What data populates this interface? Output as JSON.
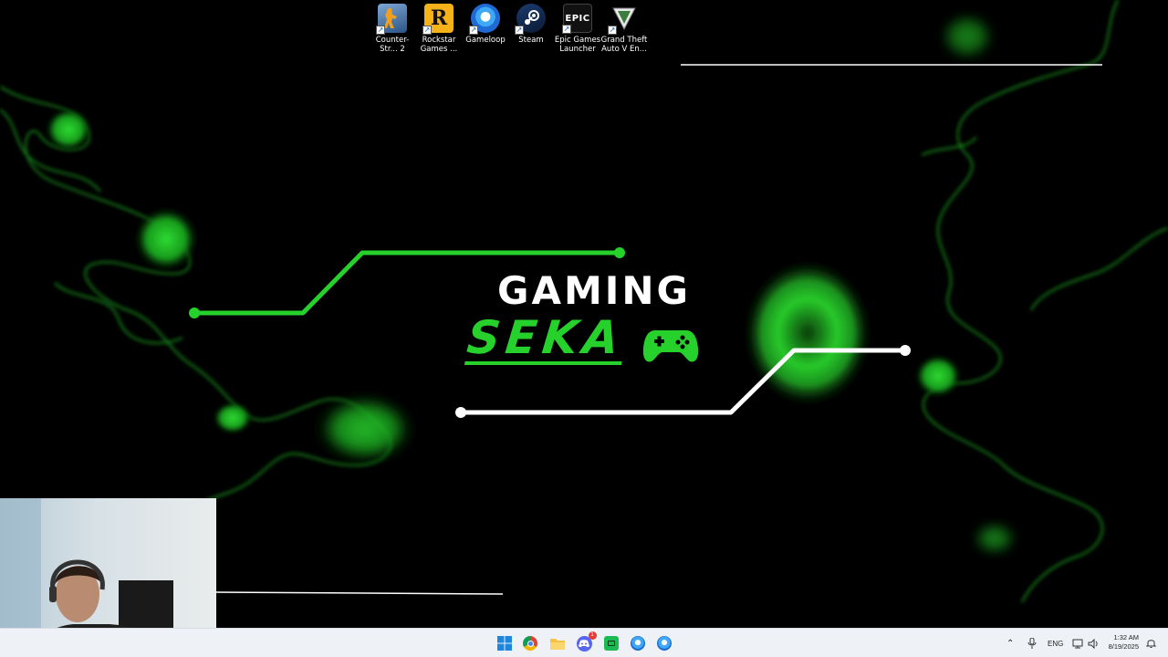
{
  "desktop": {
    "icons": [
      {
        "label": "Counter-Str... 2",
        "icon": "counter-strike-icon"
      },
      {
        "label": "Rockstar Games ...",
        "icon": "rockstar-games-icon"
      },
      {
        "label": "Gameloop",
        "icon": "gameloop-icon"
      },
      {
        "label": "Steam",
        "icon": "steam-icon"
      },
      {
        "label": "Epic Games Launcher",
        "icon": "epic-games-icon"
      },
      {
        "label": "Grand Theft Auto V En...",
        "icon": "gta-v-icon"
      }
    ],
    "epic_badge": "EPIC",
    "rockstar_badge": "R"
  },
  "wallpaper": {
    "title_line1": "GAMING",
    "title_line2": "SEKA",
    "accent_color": "#26d12b"
  },
  "taskbar": {
    "apps": [
      {
        "name": "start",
        "icon": "windows-start-icon"
      },
      {
        "name": "chrome",
        "icon": "chrome-icon"
      },
      {
        "name": "file-explorer",
        "icon": "folder-icon"
      },
      {
        "name": "discord",
        "icon": "discord-icon",
        "badge": "1"
      },
      {
        "name": "streaming-app",
        "icon": "green-app-icon"
      },
      {
        "name": "browser-1",
        "icon": "blue-globe-icon"
      },
      {
        "name": "browser-2",
        "icon": "blue-globe-icon"
      }
    ],
    "tray": {
      "language": "ENG",
      "time": "1:32 AM",
      "date": "8/19/2025"
    }
  }
}
